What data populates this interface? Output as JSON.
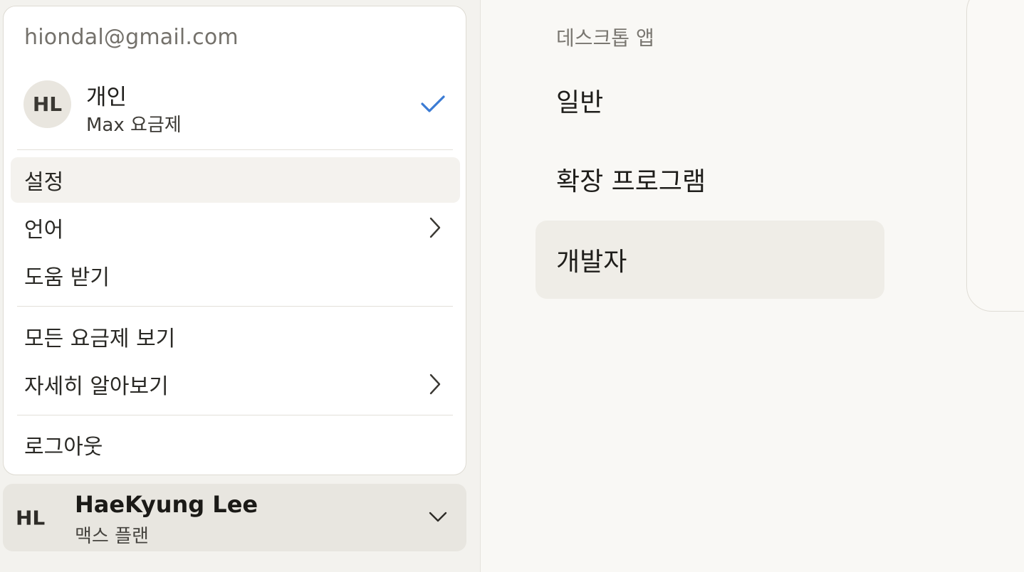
{
  "account_menu": {
    "email": "hiondal@gmail.com",
    "account": {
      "avatar_initials": "HL",
      "name": "개인",
      "plan": "Max 요금제",
      "selected_icon": "check-icon"
    },
    "items": [
      {
        "label": "설정",
        "active": true
      },
      {
        "label": "언어",
        "has_submenu": true
      },
      {
        "label": "도움 받기"
      },
      {
        "label": "모든 요금제 보기"
      },
      {
        "label": "자세히 알아보기",
        "has_submenu": true
      },
      {
        "label": "로그아웃"
      }
    ]
  },
  "user_button": {
    "initials": "HL",
    "name": "HaeKyung Lee",
    "plan": "맥스 플랜",
    "icon": "chevron-down-icon"
  },
  "settings_nav": {
    "section_title": "데스크톱 앱",
    "items": [
      {
        "label": "일반"
      },
      {
        "label": "확장 프로그램"
      },
      {
        "label": "개발자",
        "selected": true
      }
    ]
  },
  "colors": {
    "accent_check": "#3b7bd4",
    "menu_background": "#ffffff",
    "page_background": "#f9f8f5",
    "selected_background": "#efede7"
  }
}
